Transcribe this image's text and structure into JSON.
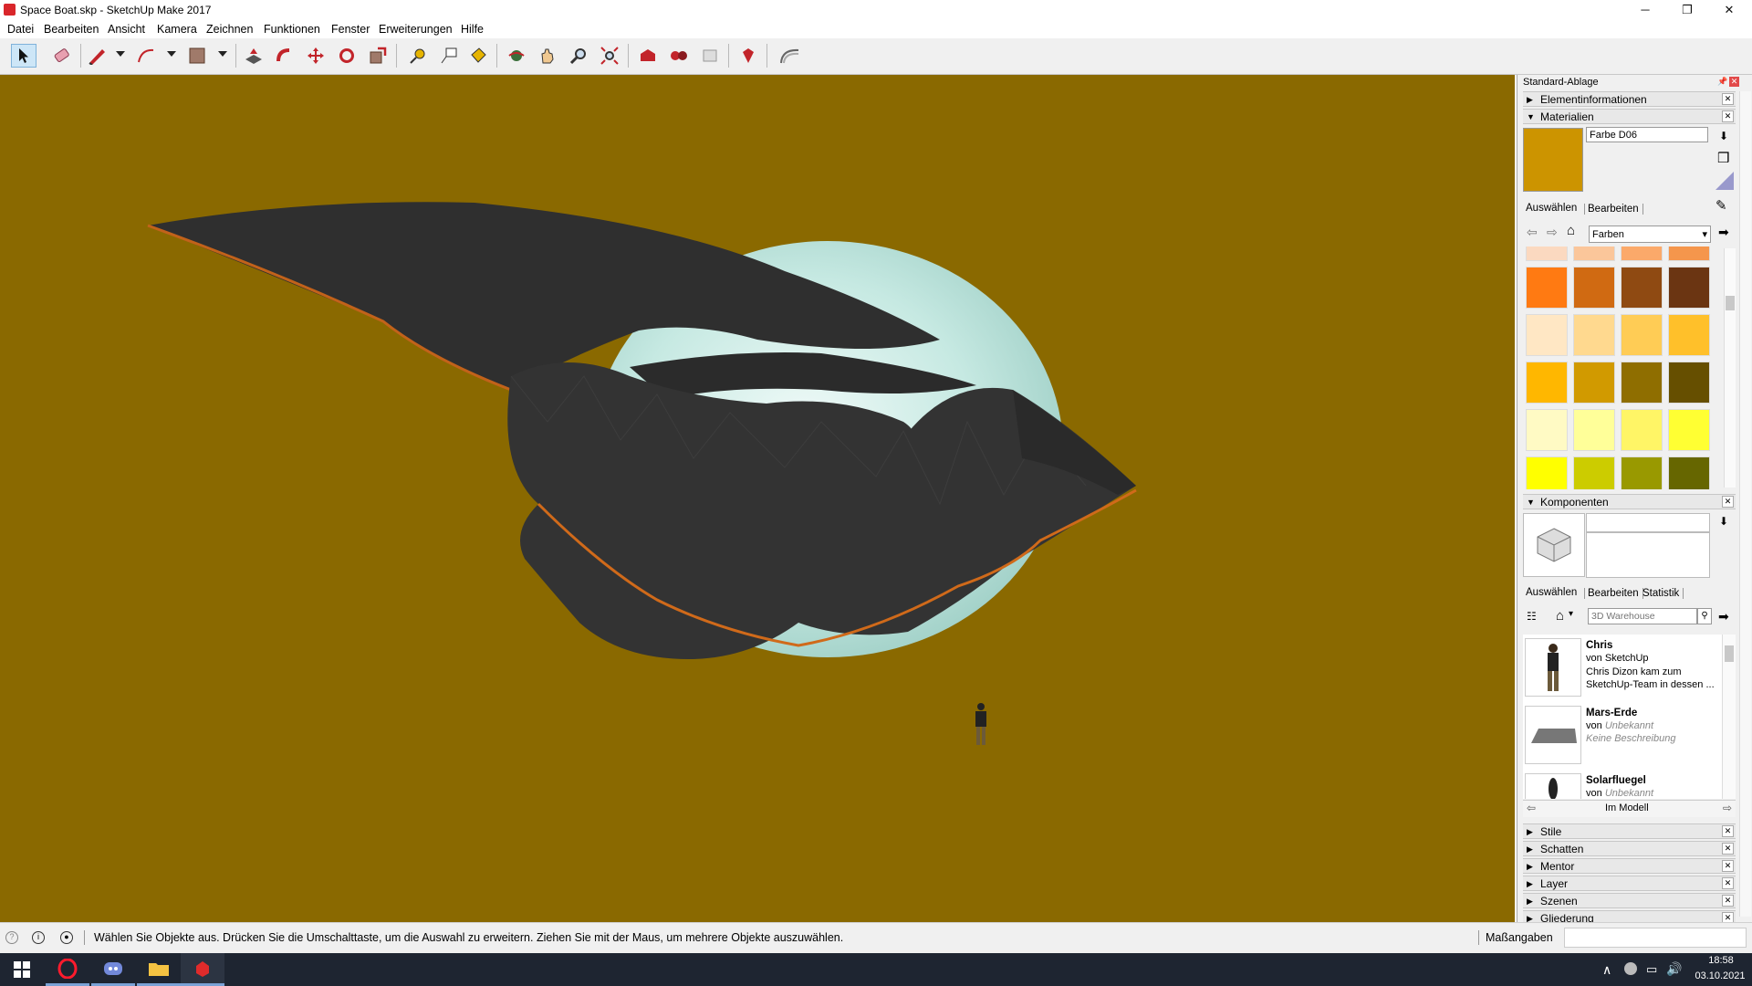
{
  "window": {
    "title": "Space Boat.skp - SketchUp Make 2017",
    "minimize": "─",
    "restore": "❐",
    "close": "✕"
  },
  "menu": [
    "Datei",
    "Bearbeiten",
    "Ansicht",
    "Kamera",
    "Zeichnen",
    "Funktionen",
    "Fenster",
    "Erweiterungen",
    "Hilfe"
  ],
  "toolbar_icons": [
    "select-icon",
    "eraser-icon",
    "pencil-icon",
    "arc-icon",
    "rectangle-icon",
    "push-pull-icon",
    "follow-me-icon",
    "move-icon",
    "rotate-icon",
    "scale-icon",
    "tape-measure-icon",
    "text-icon",
    "paint-bucket-icon",
    "orbit-icon",
    "pan-icon",
    "zoom-icon",
    "zoom-extents-icon",
    "warehouse-icon",
    "extension-warehouse-icon",
    "layout-icon",
    "ruby-icon",
    "sandbox-icon"
  ],
  "colors": {
    "viewport_bg": "#8a6900",
    "accent": "#d9262b",
    "ship_dark": "#333333",
    "dome": "#bfe3dc",
    "trim": "#d06a1a"
  },
  "tray": {
    "title": "Standard-Ablage",
    "panels": {
      "entity_info": "Elementinformationen",
      "materials": "Materialien",
      "components": "Komponenten"
    },
    "materials": {
      "name_value": "Farbe D06",
      "current_color": "#cc9400",
      "tab_select": "Auswählen",
      "tab_edit": "Bearbeiten",
      "library": "Farben",
      "swatches": [
        [
          "#fbd9c0",
          "#fbc69a",
          "#fba96a",
          "#f5964c"
        ],
        [
          "#ff7a12",
          "#d06a12",
          "#8f4a12",
          "#6b3512"
        ],
        [
          "#ffe7c4",
          "#ffd98f",
          "#ffcc55",
          "#ffc02a"
        ],
        [
          "#ffb700",
          "#d19a00",
          "#8f6e00",
          "#664f00"
        ],
        [
          "#fffac4",
          "#ffff99",
          "#fff566",
          "#ffff33"
        ],
        [
          "#ffff00",
          "#cccc00",
          "#999900",
          "#666600"
        ]
      ]
    },
    "components": {
      "tab_select": "Auswählen",
      "tab_edit": "Bearbeiten",
      "tab_stats": "Statistik",
      "search_placeholder": "3D Warehouse",
      "footer": "Im Modell",
      "items": [
        {
          "name": "Chris",
          "author_prefix": "von",
          "author": "SketchUp",
          "desc": "Chris Dizon kam zum SketchUp-Team in dessen ..."
        },
        {
          "name": "Mars-Erde",
          "author_prefix": "von",
          "author": "Unbekannt",
          "desc": "Keine Beschreibung"
        },
        {
          "name": "Solarfluegel",
          "author_prefix": "von",
          "author": "Unbekannt",
          "desc": ""
        }
      ]
    },
    "collapsed_panels": [
      "Stile",
      "Schatten",
      "Mentor",
      "Layer",
      "Szenen",
      "Gliederung"
    ]
  },
  "status": {
    "hint": "Wählen Sie Objekte aus. Drücken Sie die Umschalttaste, um die Auswahl zu erweitern. Ziehen Sie mit der Maus, um mehrere Objekte auszuwählen.",
    "measurements_label": "Maßangaben",
    "measurements_value": ""
  },
  "taskbar": {
    "time": "18:58",
    "date": "03.10.2021"
  }
}
